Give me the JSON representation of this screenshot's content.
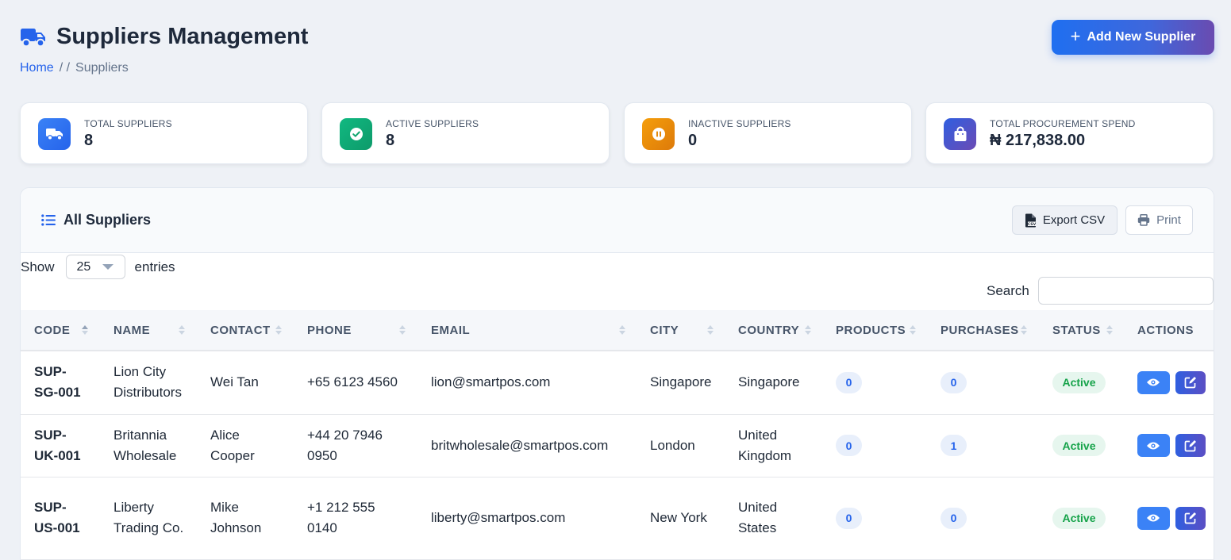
{
  "header": {
    "title": "Suppliers Management",
    "add_button": "Add New Supplier",
    "breadcrumb": {
      "home": "Home",
      "separator": "/ /",
      "current": "Suppliers"
    }
  },
  "stats": [
    {
      "label": "TOTAL SUPPLIERS",
      "value": "8",
      "icon": "truck-icon",
      "color": "#2f6ff0"
    },
    {
      "label": "ACTIVE SUPPLIERS",
      "value": "8",
      "icon": "check-circle-icon",
      "color": "#10a56f"
    },
    {
      "label": "INACTIVE SUPPLIERS",
      "value": "0",
      "icon": "pause-circle-icon",
      "color": "#e58a0c"
    },
    {
      "label": "TOTAL PROCUREMENT SPEND",
      "value": "₦ 217,838.00",
      "icon": "shopping-bag-icon",
      "color": "#4a57d0"
    }
  ],
  "panel": {
    "title": "All Suppliers",
    "export_label": "Export CSV",
    "print_label": "Print",
    "length": {
      "show": "Show",
      "value": "25",
      "entries": "entries"
    },
    "search_label": "Search",
    "search_value": ""
  },
  "table": {
    "columns": [
      "CODE",
      "NAME",
      "CONTACT",
      "PHONE",
      "EMAIL",
      "CITY",
      "COUNTRY",
      "PRODUCTS",
      "PURCHASES",
      "STATUS",
      "ACTIONS"
    ],
    "rows": [
      {
        "code": "SUP-SG-001",
        "name": "Lion City Distributors",
        "contact": "Wei Tan",
        "phone": "+65 6123 4560",
        "email": "lion@smartpos.com",
        "city": "Singapore",
        "country": "Singapore",
        "products": "0",
        "purchases": "0",
        "status": "Active"
      },
      {
        "code": "SUP-UK-001",
        "name": "Britannia Wholesale",
        "contact": "Alice Cooper",
        "phone": "+44 20 7946 0950",
        "email": "britwholesale@smartpos.com",
        "city": "London",
        "country": "United Kingdom",
        "products": "0",
        "purchases": "1",
        "status": "Active"
      },
      {
        "code": "SUP-US-001",
        "name": "Liberty Trading Co.",
        "contact": "Mike Johnson",
        "phone": "+1 212 555 0140",
        "email": "liberty@smartpos.com",
        "city": "New York",
        "country": "United States",
        "products": "0",
        "purchases": "0",
        "status": "Active"
      }
    ]
  },
  "colors": {
    "accent": "#2563eb",
    "status_active_bg": "#e6f6ee",
    "status_active_text": "#16a34a",
    "count_pill_bg": "#e8effb"
  }
}
